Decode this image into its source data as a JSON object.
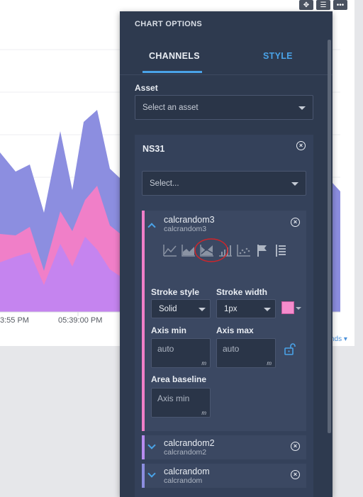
{
  "background_chart": {
    "tick_labels": [
      "3:55 PM",
      "05:39:00 PM"
    ],
    "legend_link": "nds",
    "colors": {
      "series_a": "#8c8ee0",
      "series_b": "#f07fc8",
      "series_c": "#c584ef"
    }
  },
  "toolbar": {
    "icons": [
      "move-icon",
      "sliders-icon",
      "more-icon"
    ],
    "more_label": "•••"
  },
  "panel": {
    "title": "CHART OPTIONS",
    "tabs": [
      {
        "label": "CHANNELS",
        "active": true
      },
      {
        "label": "STYLE",
        "active": false
      }
    ],
    "asset": {
      "label": "Asset",
      "placeholder": "Select an asset"
    },
    "group": {
      "name": "NS31",
      "select_placeholder": "Select...",
      "channels": [
        {
          "name": "calcrandom3",
          "sub": "calcrandom3",
          "expanded": true,
          "color": "#f07fc8",
          "chart_type_icons": [
            "line-chart-icon",
            "area-chart-icon",
            "stacked-area-chart-icon",
            "bar-chart-icon",
            "scatter-chart-icon",
            "flag-icon",
            "list-icon"
          ],
          "stroke_style": {
            "label": "Stroke style",
            "value": "Solid"
          },
          "stroke_width": {
            "label": "Stroke width",
            "value": "1px"
          },
          "swatch_color": "#f58ccd",
          "axis_min": {
            "label": "Axis min",
            "value": "auto"
          },
          "axis_max": {
            "label": "Axis max",
            "value": "auto"
          },
          "area_baseline": {
            "label": "Area baseline",
            "placeholder": "Axis min"
          },
          "unit_marker": "m"
        },
        {
          "name": "calcrandom2",
          "sub": "calcrandom2",
          "expanded": false,
          "color": "#b78cf0"
        },
        {
          "name": "calcrandom",
          "sub": "calcrandom",
          "expanded": false,
          "color": "#8c8ee0"
        }
      ]
    }
  }
}
